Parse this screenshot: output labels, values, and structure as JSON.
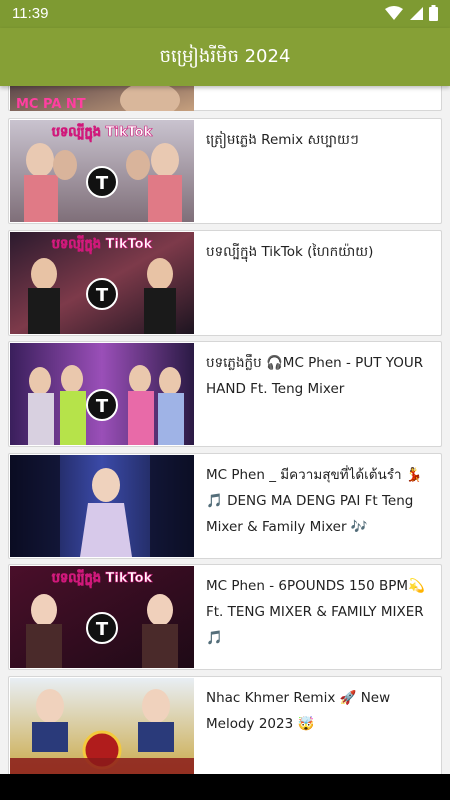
{
  "status": {
    "time": "11:39"
  },
  "header": {
    "title": "ចម្រៀងរីមិច 2024"
  },
  "partial_top": {
    "label": "MC PA NT"
  },
  "videos": [
    {
      "title": "ត្រៀមភ្លេង Remix សប្បាយៗ",
      "badge": "បទល្បីក្នុង TikTok"
    },
    {
      "title": "បទល្បីក្នុង TikTok (ហៃកយ៉ាយ)",
      "badge": "បទល្បីក្នុង TikTok"
    },
    {
      "title": "បទភ្លេងក្លឹប 🎧MC Phen - PUT YOUR HAND Ft. Teng Mixer",
      "badge": ""
    },
    {
      "title": "MC Phen _ มีความสุขที่ได้เต้นรำ 💃🎵 DENG MA DENG PAI Ft Teng Mixer & Family Mixer 🎶",
      "badge": ""
    },
    {
      "title": "MC Phen - 6POUNDS 150 BPM💫 Ft. TENG MIXER & FAMILY MIXER 🎵",
      "badge": "បទល្បីក្នុង TikTok"
    },
    {
      "title": "Nhac Khmer Remix 🚀 New Melody 2023 🤯",
      "badge": ""
    }
  ],
  "colors": {
    "app_bar": "#86a036",
    "status_bar": "#7e9a32"
  }
}
